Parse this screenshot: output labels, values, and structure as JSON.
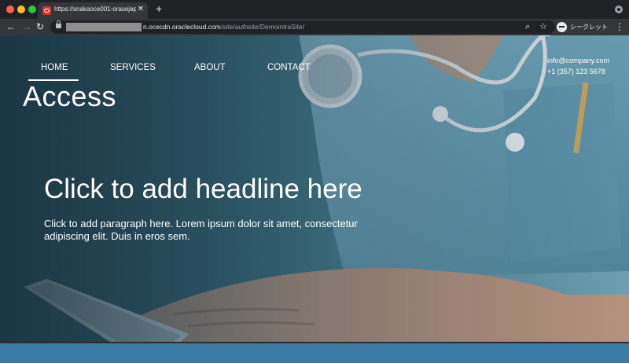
{
  "browser": {
    "tab_title": "https://snakaoce001-orasejap",
    "tab_close": "✕",
    "new_tab": "+",
    "url_host": "n.ocecdn.oraclecloud.com",
    "url_path": "/site/authsite/DemointraSite/",
    "incognito_label": "シークレット",
    "icons": {
      "back": "arrow-left-icon",
      "forward": "arrow-right-icon",
      "reload": "reload-icon",
      "lock": "lock-icon",
      "zoom": "zoom-icon",
      "bookmark": "star-icon",
      "menu": "kebab-menu-icon"
    }
  },
  "site": {
    "nav": [
      "HOME",
      "SERVICES",
      "ABOUT",
      "CONTACT"
    ],
    "active_nav": "HOME",
    "title": "Access",
    "contact_email": "info@company.com",
    "contact_phone": "+1 (357) 123 5678",
    "headline": "Click to add headline here",
    "paragraph": "Click to add paragraph here. Lorem ipsum dolor sit amet, consectetur adipiscing elit. Duis in eros sem."
  },
  "colors": {
    "chrome_bg": "#202124",
    "toolbar_bg": "#35363a",
    "hero_dark": "#1f3d49",
    "hero_light": "#6e9fb2",
    "bottom_band": "#3c7aa6",
    "text": "#ffffff"
  }
}
